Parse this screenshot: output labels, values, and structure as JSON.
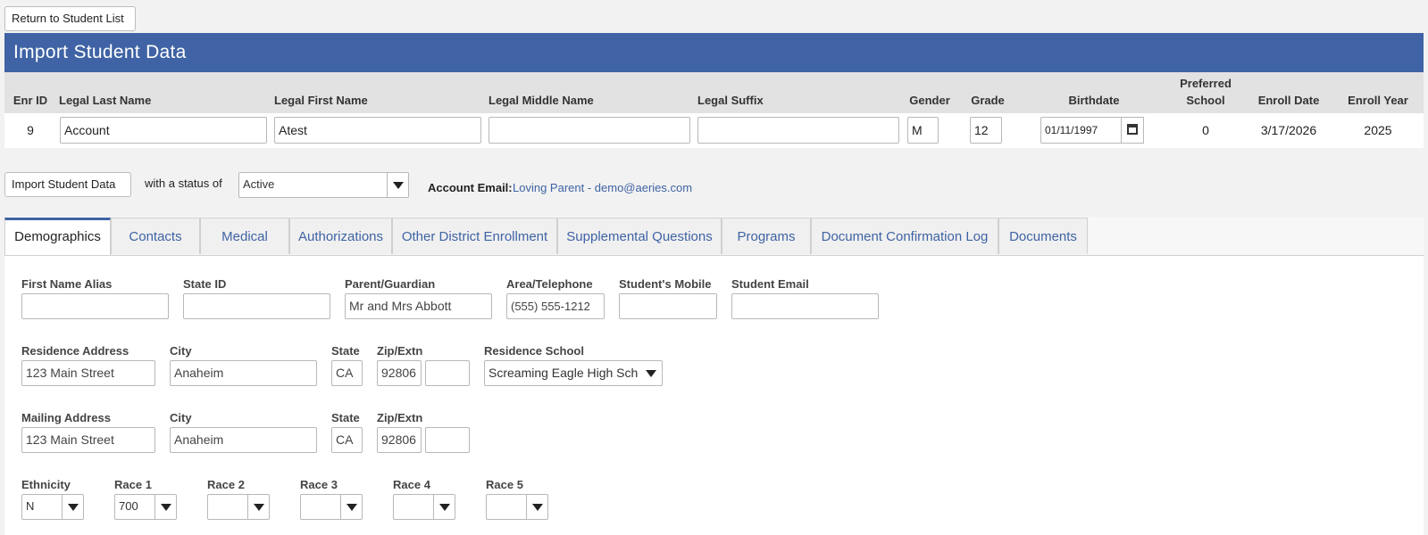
{
  "top": {
    "return_label": "Return to Student List",
    "page_title": "Import Student Data"
  },
  "student": {
    "headers": {
      "enr_id": "Enr ID",
      "last": "Legal Last Name",
      "first": "Legal First Name",
      "middle": "Legal Middle Name",
      "suffix": "Legal Suffix",
      "gender": "Gender",
      "grade": "Grade",
      "birthdate": "Birthdate",
      "preferred_school": "Preferred\nSchool",
      "enroll_date": "Enroll Date",
      "enroll_year": "Enroll Year"
    },
    "enr_id": "9",
    "last_name": "Account",
    "first_name": "Atest",
    "middle_name": "",
    "suffix": "",
    "gender": "M",
    "grade": "12",
    "birthdate": "01/11/1997",
    "preferred_school": "0",
    "enroll_date": "3/17/2026",
    "enroll_year": "2025"
  },
  "import": {
    "button_label": "Import Student Data",
    "status_prefix": "with a status of",
    "status_value": "Active",
    "account_email_label": "Account Email:",
    "account_email_value": "Loving Parent - demo@aeries.com"
  },
  "tabs": [
    {
      "label": "Demographics",
      "active": true
    },
    {
      "label": "Contacts"
    },
    {
      "label": "Medical"
    },
    {
      "label": "Authorizations"
    },
    {
      "label": "Other District Enrollment"
    },
    {
      "label": "Supplemental Questions"
    },
    {
      "label": "Programs"
    },
    {
      "label": "Document Confirmation Log"
    },
    {
      "label": "Documents"
    }
  ],
  "demographics": {
    "labels": {
      "first_name_alias": "First Name Alias",
      "state_id": "State ID",
      "parent_guardian": "Parent/Guardian",
      "area_telephone": "Area/Telephone",
      "students_mobile": "Student's Mobile",
      "student_email": "Student Email",
      "residence_address": "Residence Address",
      "city": "City",
      "state": "State",
      "zip_extn": "Zip/Extn",
      "residence_school": "Residence School",
      "mailing_address": "Mailing Address",
      "ethnicity": "Ethnicity",
      "race1": "Race 1",
      "race2": "Race 2",
      "race3": "Race 3",
      "race4": "Race 4",
      "race5": "Race 5"
    },
    "first_name_alias": "",
    "state_id": "",
    "parent_guardian": "Mr and Mrs Abbott",
    "area_telephone": "(555) 555-1212",
    "students_mobile": "",
    "student_email": "",
    "residence": {
      "address": "123 Main Street",
      "city": "Anaheim",
      "state": "CA",
      "zip": "92806",
      "extn": "",
      "school": "Screaming Eagle High School"
    },
    "mailing": {
      "address": "123 Main Street",
      "city": "Anaheim",
      "state": "CA",
      "zip": "92806",
      "extn": ""
    },
    "ethnicity": "N",
    "race1": "700",
    "race2": "",
    "race3": "",
    "race4": "",
    "race5": ""
  },
  "colors": {
    "header_blue": "#3f63a4",
    "link_blue": "#3f63a4"
  }
}
